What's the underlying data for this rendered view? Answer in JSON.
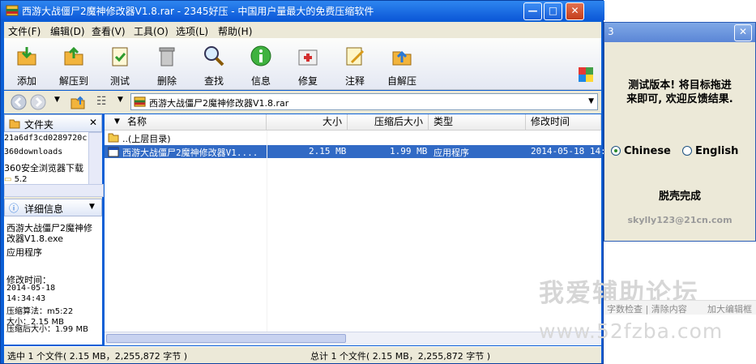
{
  "window": {
    "title": "西游大战僵尸2魔神修改器V1.8.rar - 2345好压 - 中国用户量最大的免费压缩软件",
    "min": "—",
    "max": "□",
    "close": "✕"
  },
  "menu": [
    "文件(F)",
    "编辑(D)",
    "查看(V)",
    "工具(O)",
    "选项(L)",
    "帮助(H)"
  ],
  "toolbar": [
    "添加",
    "解压到",
    "测试",
    "删除",
    "查找",
    "信息",
    "修复",
    "注释",
    "自解压"
  ],
  "address": {
    "path": "西游大战僵尸2魔神修改器V1.8.rar",
    "dropdown": "▼"
  },
  "folders": {
    "header": "文件夹",
    "items": [
      "21a6df3cd0289720c",
      "360downloads",
      "360安全浏览器下载",
      "5.2"
    ]
  },
  "details": {
    "header": "详细信息",
    "name": "西游大战僵尸2魔神修改器V1.8.exe",
    "type": "应用程序",
    "modified_label": "修改时间：",
    "date": "2014-05-18",
    "time": "14:34:43",
    "algo": "压缩算法：m5:22",
    "size": "大小：2.15 MB",
    "packed": "压缩后大小：1.99 MB"
  },
  "columns": [
    "名称",
    "大小",
    "压缩后大小",
    "类型",
    "修改时间"
  ],
  "rows": [
    {
      "name": "..(上层目录)",
      "size": "",
      "packed": "",
      "type": "",
      "modified": ""
    },
    {
      "name": "西游大战僵尸2魔神修改器V1....",
      "size": "2.15 MB",
      "packed": "1.99 MB",
      "type": "应用程序",
      "modified": "2014-05-18 14:3"
    }
  ],
  "status": {
    "left": "选中 1 个文件( 2.15 MB，2,255,872 字节 )",
    "right": "总计 1 个文件( 2.15 MB，2,255,872 字节 )"
  },
  "dialog": {
    "title": "3",
    "close": "✕",
    "message1": "测试版本! 将目标拖进",
    "message2": "来即可, 欢迎反馈结果.",
    "option_chinese": "Chinese",
    "option_english": "English",
    "done": "脱壳完成",
    "email": "skylly123@21cn.com"
  },
  "watermark": {
    "site_name": "我爱辅助论坛",
    "bar_links": "字数检查 | 清除内容",
    "bar_right": "加大编辑框",
    "url": "www.52fzba.com"
  },
  "colors": {
    "title_blue": "#0c58d8",
    "selection": "#316ac5",
    "panel": "#ece9d8"
  }
}
